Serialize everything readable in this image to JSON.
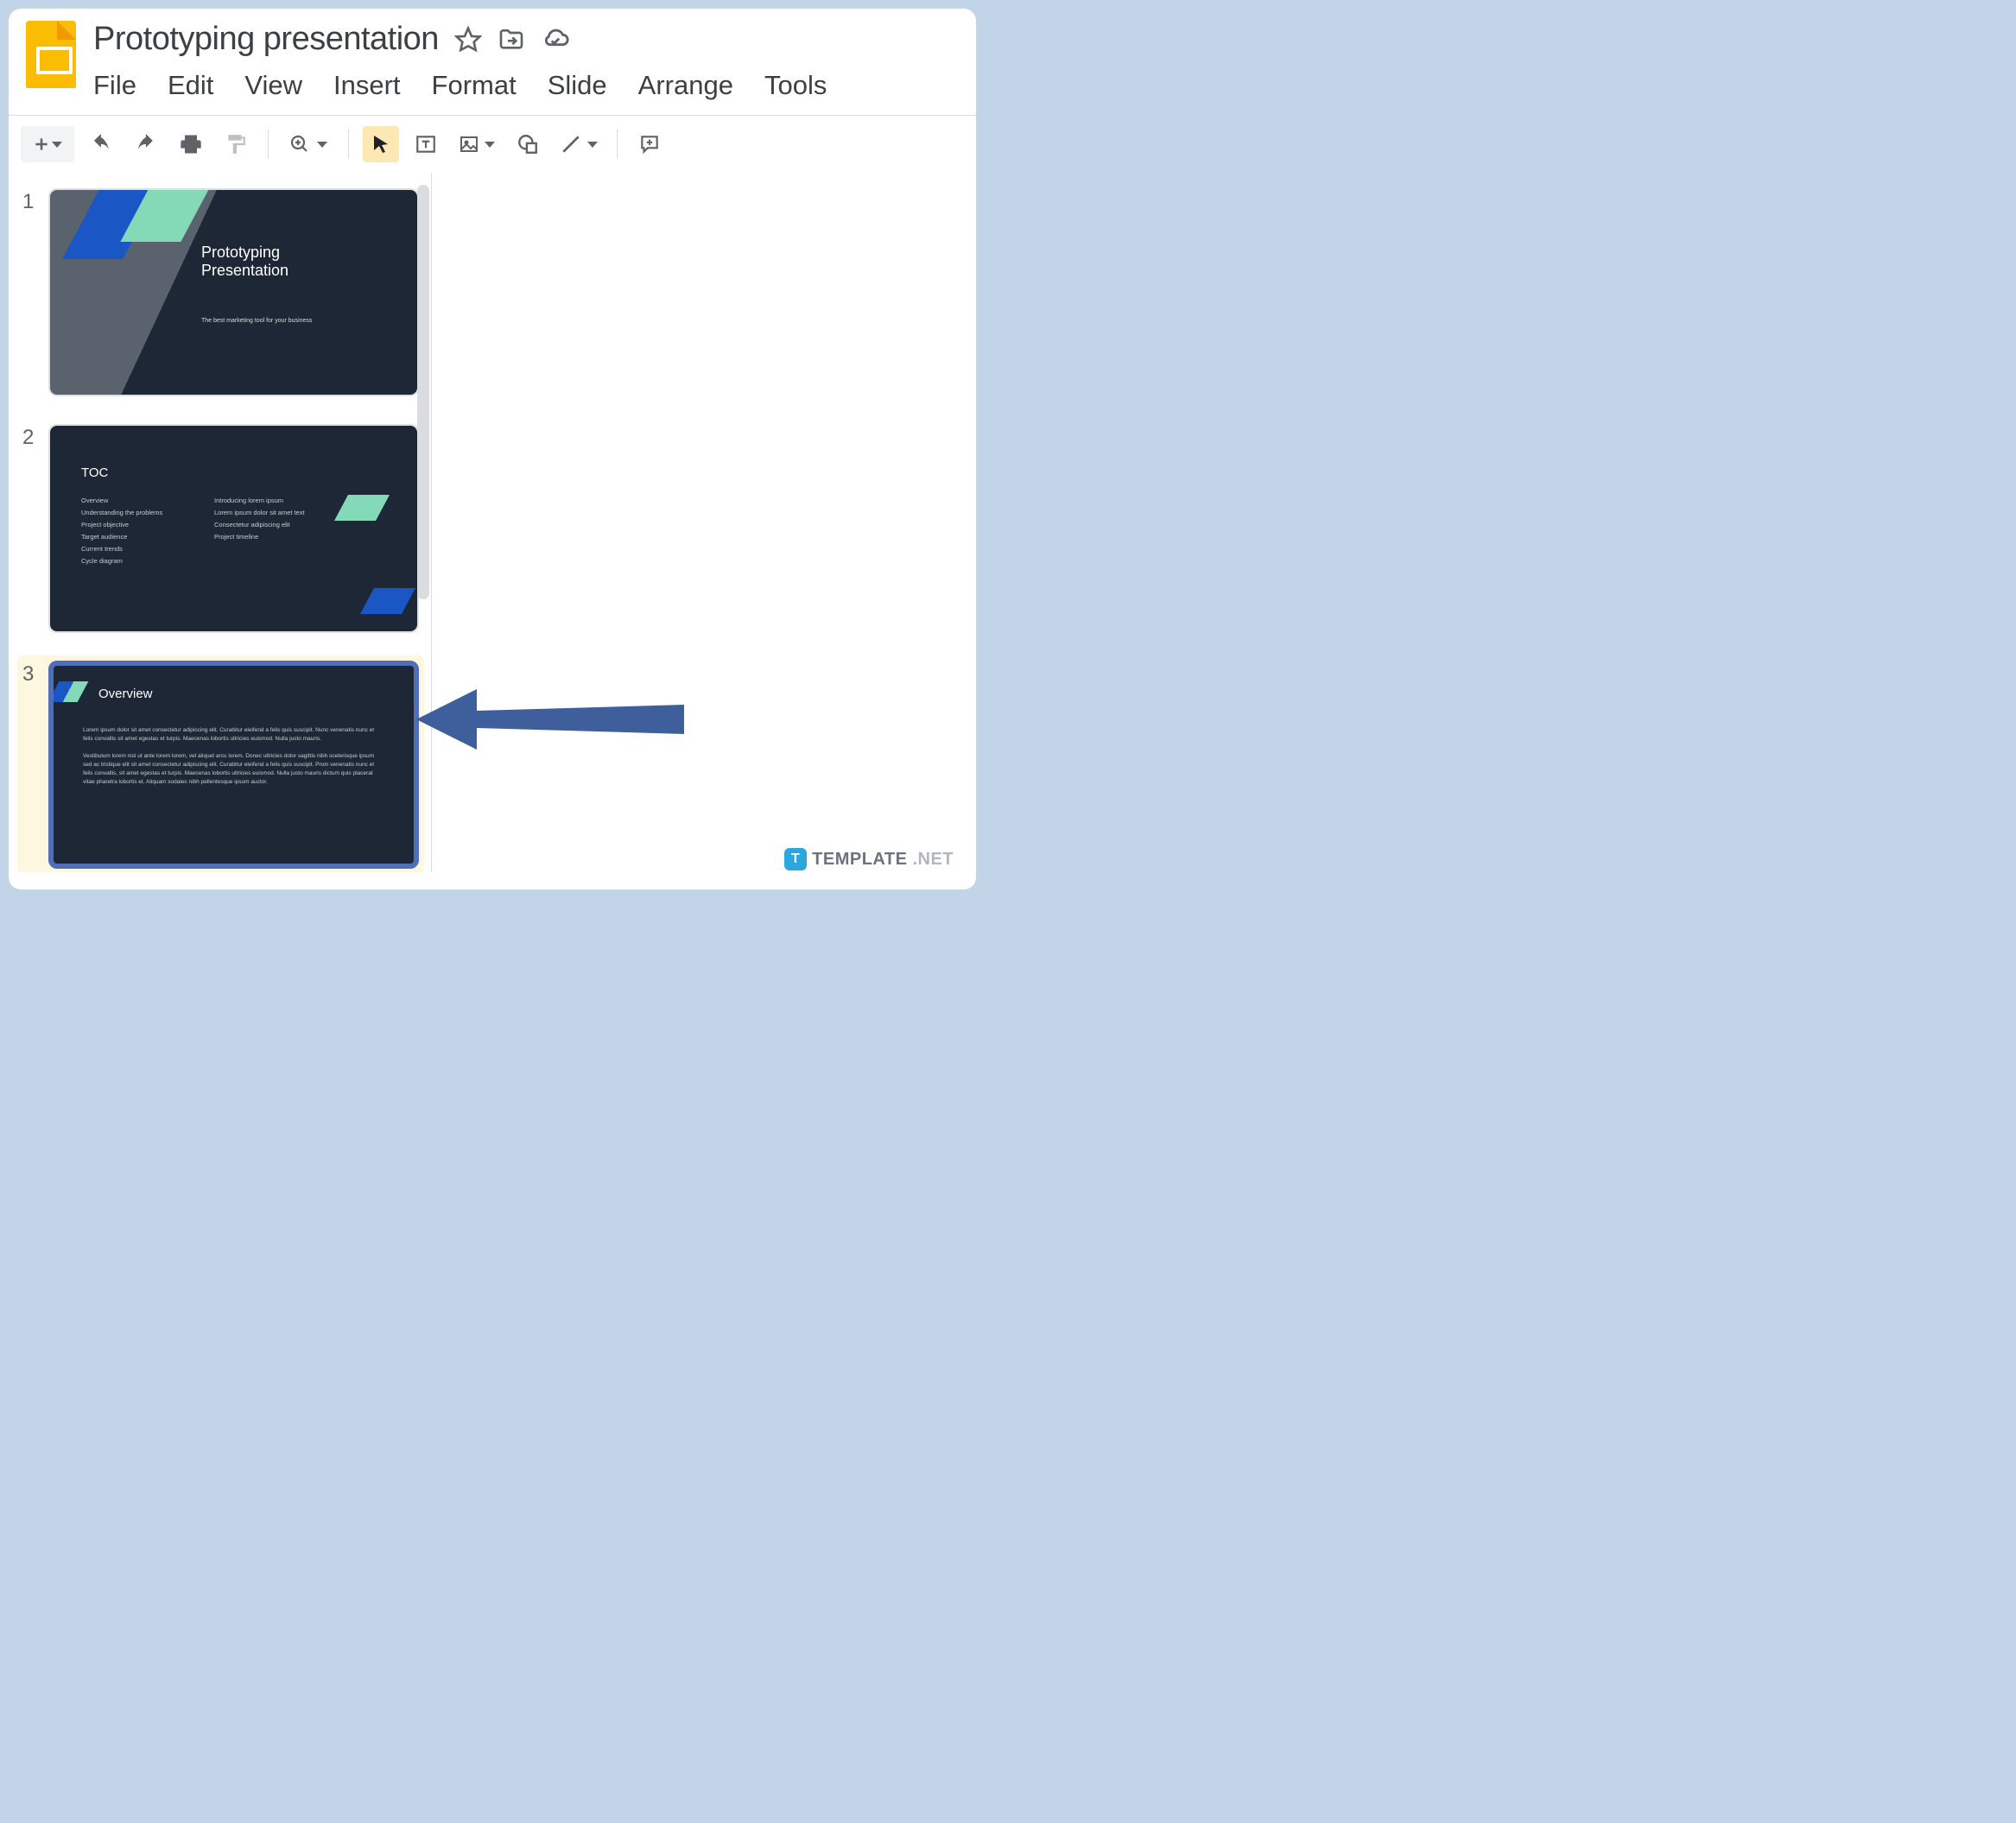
{
  "doc_title": "Prototyping presentation",
  "menus": {
    "file": "File",
    "edit": "Edit",
    "view": "View",
    "insert": "Insert",
    "format": "Format",
    "slide": "Slide",
    "arrange": "Arrange",
    "tools": "Tools"
  },
  "filmstrip": {
    "slides": [
      {
        "num": "1",
        "title": "Prototyping\nPresentation",
        "subtitle": "The best marketing tool for your business"
      },
      {
        "num": "2",
        "title": "TOC",
        "col1": "Overview\nUnderstanding the problems\nProject objective\nTarget audience\nCurrent trends\nCycle diagram",
        "col2": "Introducing lorem ipsum\nLorem ipsum dolor sit amet text\nConsectetur adipiscing elit\nProject timeline"
      },
      {
        "num": "3",
        "title": "Overview",
        "body": "Lorem ipsum dolor sit amet consectetur adipiscing elit. Curabitur eleifend a felis quis suscipit. Nunc venenatis nunc et felis convallis sit amet egestas et turpis. Maecenas lobortis ultricies euismod. Nulla justo mauris.\n\nVestibulum lorem nisl ut ante lorem lorem, vel aliquet arcu lorem. Donec ultricies dolor sagittis nibh scelerisque ipsum sed ac tristique elit sit amet consectetur adipiscing elit. Curabitur eleifend a felis quis suscipit. Proin venenatis nunc et felis convallis, sit amet egestas et turpis. Maecenas lobortis ultricies euismod. Nulla justo mauris dictum quis placerat vitae pharetra lobortis et. Aliquam sodales nibh pellentesque ipsum auctor."
      }
    ],
    "selected_index": 2
  },
  "watermark": {
    "badge": "T",
    "brand": "TEMPLATE",
    "suffix": ".NET"
  }
}
